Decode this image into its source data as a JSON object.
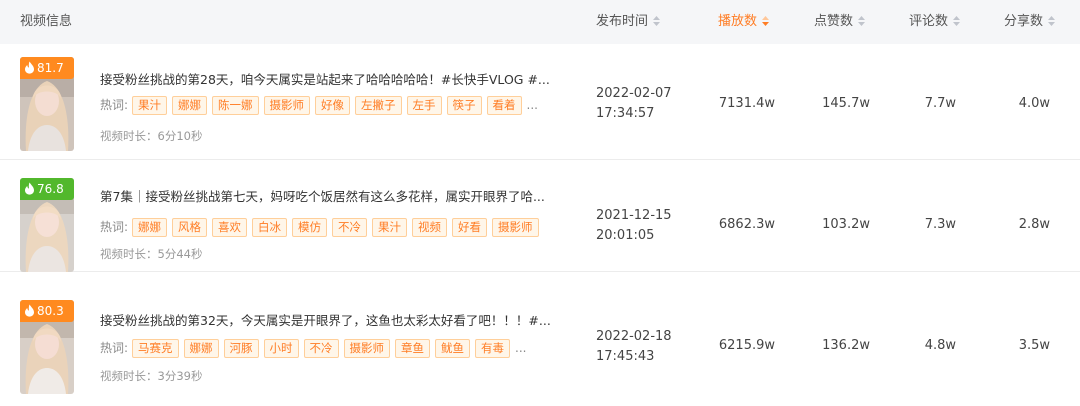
{
  "header": {
    "video_info": "视频信息",
    "publish_time": "发布时间",
    "plays": "播放数",
    "likes": "点赞数",
    "comments": "评论数",
    "shares": "分享数"
  },
  "labels": {
    "hotwords": "热词:",
    "ellipsis": "..."
  },
  "colors": {
    "accent": "#ff7d25",
    "score_orange": "#ff8a1f",
    "score_green": "#52b82c"
  },
  "rows": [
    {
      "score": "81.7",
      "score_color": "orange",
      "title": "接受粉丝挑战的第28天，咱今天属实是站起来了哈哈哈哈哈！#长快手VLOG #...",
      "tags": [
        "果汁",
        "娜娜",
        "陈一娜",
        "摄影师",
        "好像",
        "左撇子",
        "左手",
        "筷子",
        "看着"
      ],
      "duration": "视频时长：6分10秒",
      "date": "2022-02-07",
      "time": "17:34:57",
      "plays": "7131.4w",
      "likes": "145.7w",
      "comments": "7.7w",
      "shares": "4.0w"
    },
    {
      "score": "76.8",
      "score_color": "green",
      "title": "第7集｜接受粉丝挑战第七天，妈呀吃个饭居然有这么多花样，属实开眼界了哈...",
      "tags": [
        "娜娜",
        "风格",
        "喜欢",
        "白冰",
        "模仿",
        "不冷",
        "果汁",
        "视频",
        "好看",
        "摄影师"
      ],
      "duration": "视频时长：5分44秒",
      "date": "2021-12-15",
      "time": "20:01:05",
      "plays": "6862.3w",
      "likes": "103.2w",
      "comments": "7.3w",
      "shares": "2.8w"
    },
    {
      "score": "80.3",
      "score_color": "orange",
      "title": "接受粉丝挑战的第32天，今天属实是开眼界了，这鱼也太彩太好看了吧！！！#...",
      "tags": [
        "马赛克",
        "娜娜",
        "河豚",
        "小时",
        "不冷",
        "摄影师",
        "章鱼",
        "鱿鱼",
        "有毒"
      ],
      "duration": "视频时长：3分39秒",
      "date": "2022-02-18",
      "time": "17:45:43",
      "plays": "6215.9w",
      "likes": "136.2w",
      "comments": "4.8w",
      "shares": "3.5w"
    }
  ]
}
